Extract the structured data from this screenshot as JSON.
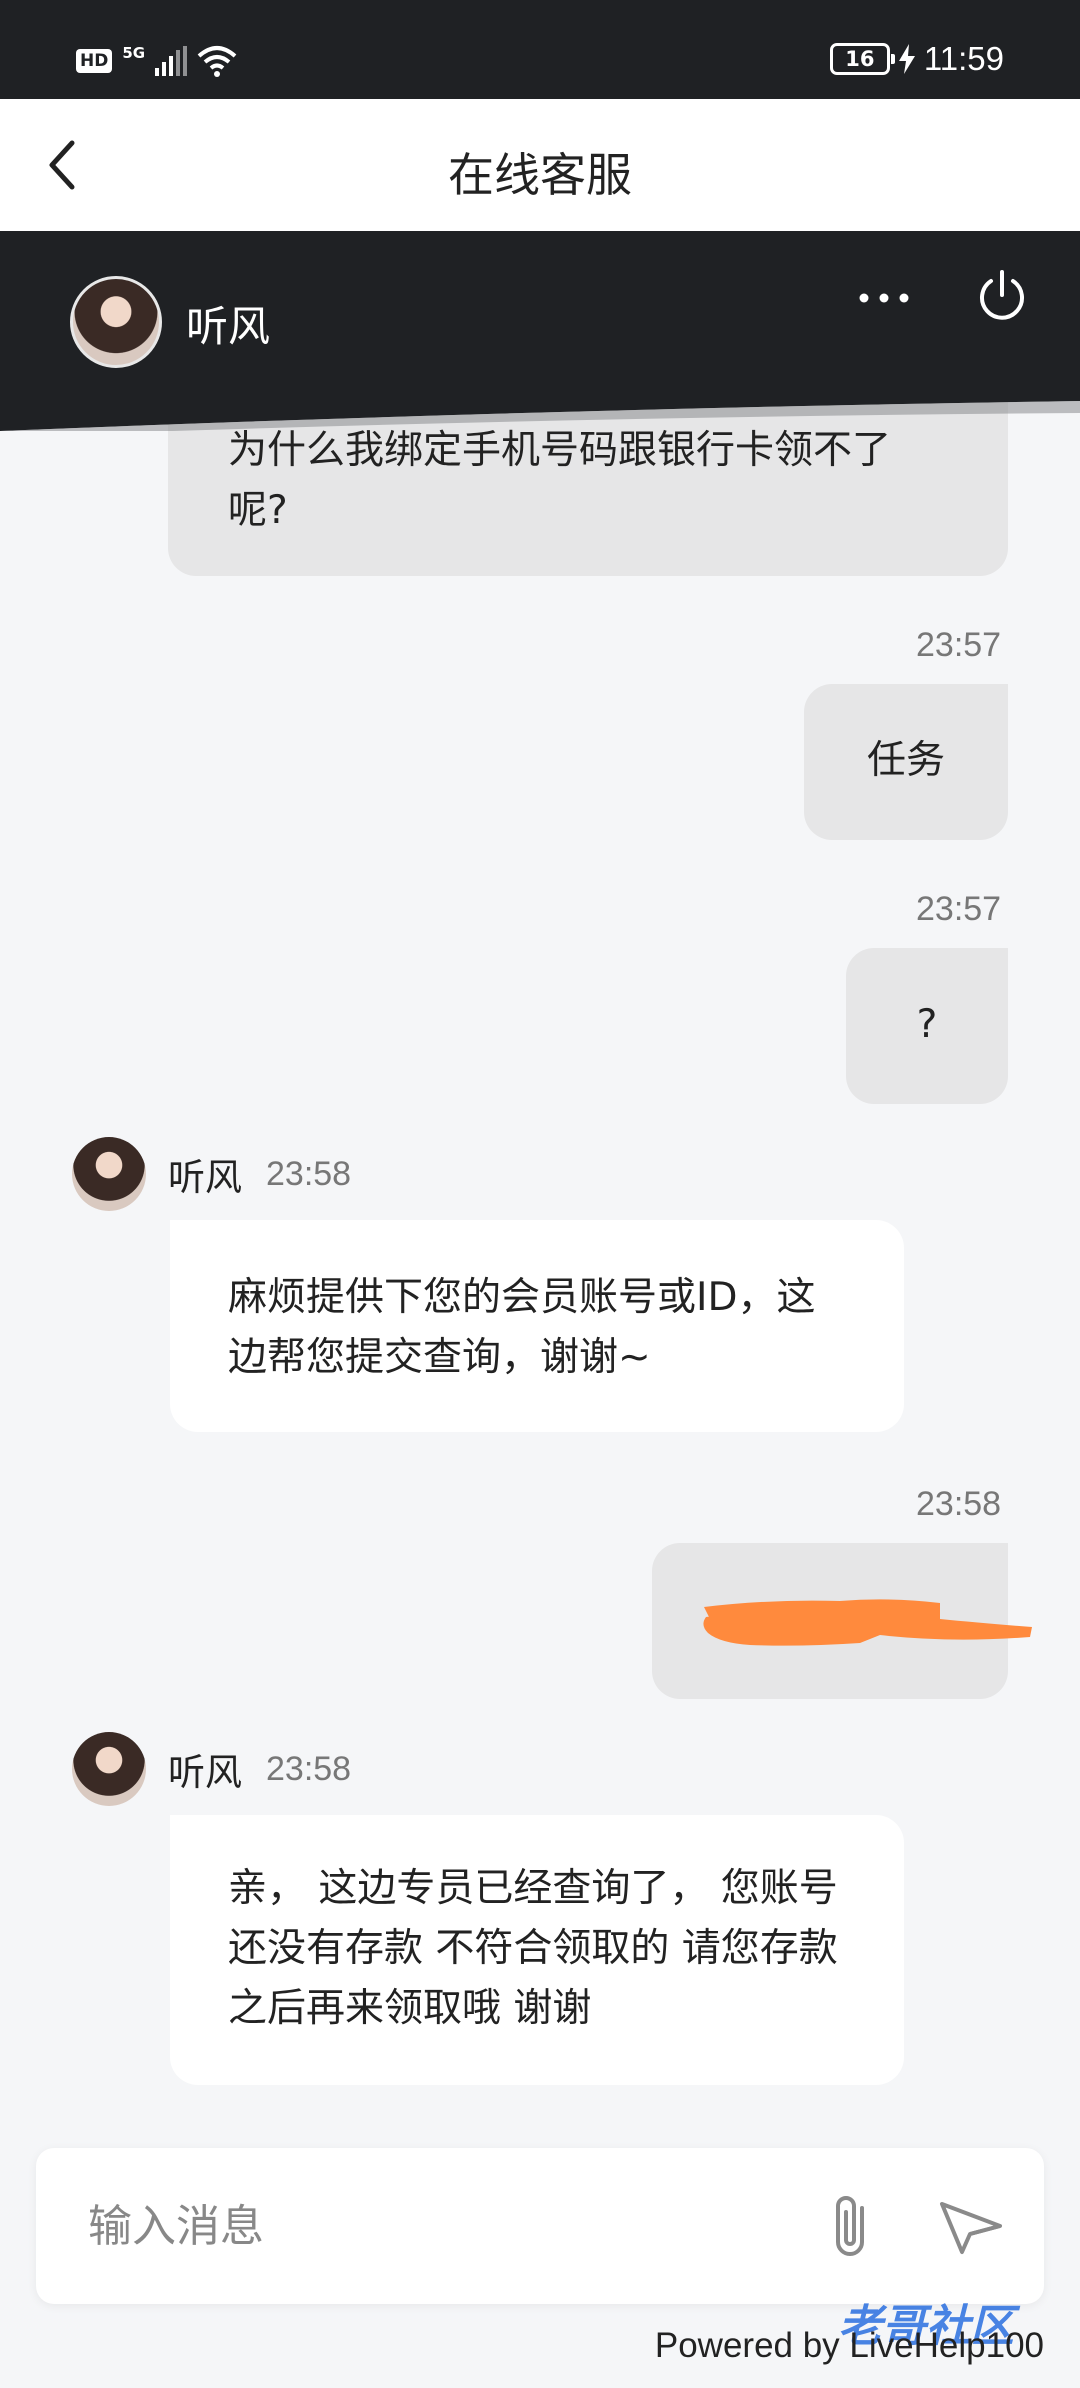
{
  "status_bar": {
    "hd": "HD",
    "network": "5G",
    "battery": "16",
    "time": "11:59"
  },
  "nav": {
    "title": "在线客服"
  },
  "agent": {
    "name": "听风"
  },
  "messages": [
    {
      "side": "right",
      "text": "为什么我绑定手机号码跟银行卡领不了呢?"
    },
    {
      "side": "right",
      "time": "23:57",
      "text": "任务"
    },
    {
      "side": "right",
      "time": "23:57",
      "text": "?"
    },
    {
      "side": "left",
      "name": "听风",
      "time": "23:58",
      "text": "麻烦提供下您的会员账号或ID，这边帮您提交查询，谢谢~"
    },
    {
      "side": "right",
      "time": "23:58",
      "text": ""
    },
    {
      "side": "left",
      "name": "听风",
      "time": "23:58",
      "text": "亲， 这边专员已经查询了， 您账号还没有存款 不符合领取的 请您存款之后再来领取哦 谢谢"
    }
  ],
  "input": {
    "placeholder": "输入消息"
  },
  "footer": {
    "powered": "Powered by LiveHelp100",
    "watermark": "老哥社区"
  },
  "colors": {
    "redaction": "#ff8a3d",
    "header_dark": "#1f2124"
  },
  "icons": [
    "back-icon",
    "more-icon",
    "power-icon",
    "attach-icon",
    "send-icon"
  ]
}
